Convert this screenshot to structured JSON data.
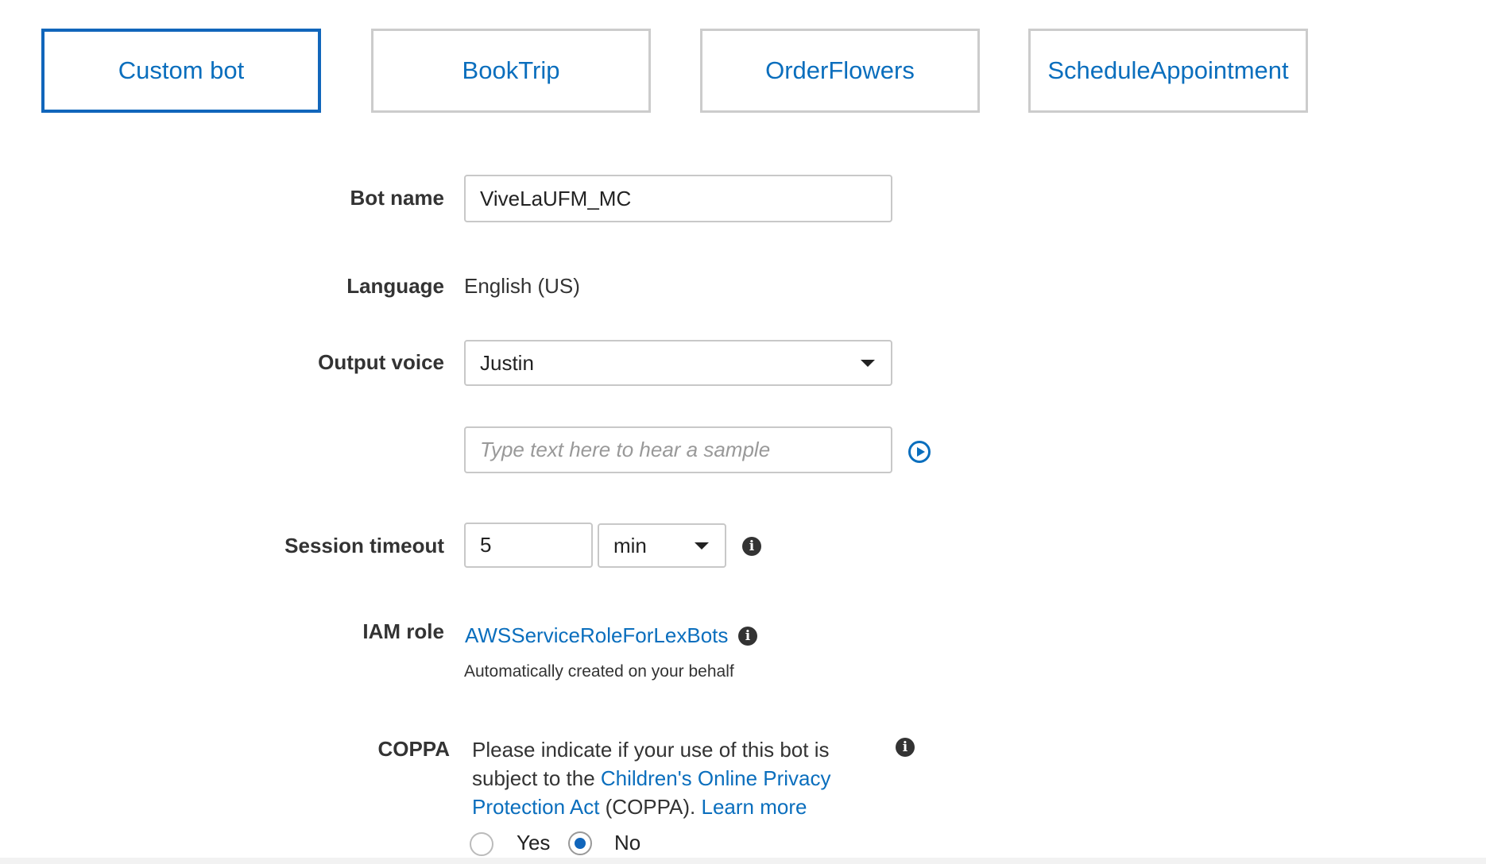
{
  "blueprints": [
    {
      "label": "Custom bot",
      "selected": true
    },
    {
      "label": "BookTrip",
      "selected": false
    },
    {
      "label": "OrderFlowers",
      "selected": false
    },
    {
      "label": "ScheduleAppointment",
      "selected": false
    }
  ],
  "form": {
    "bot_name": {
      "label": "Bot name",
      "value": "ViveLaUFM_MC"
    },
    "language": {
      "label": "Language",
      "value": "English (US)"
    },
    "output_voice": {
      "label": "Output voice",
      "selected": "Justin"
    },
    "sample": {
      "placeholder": "Type text here to hear a sample"
    },
    "session_timeout": {
      "label": "Session timeout",
      "value": "5",
      "unit": "min"
    },
    "iam_role": {
      "label": "IAM role",
      "role_link": "AWSServiceRoleForLexBots",
      "note": "Automatically created on your behalf"
    },
    "coppa": {
      "label": "COPPA",
      "text_before": "Please indicate if your use of this bot is subject to the ",
      "act_link": "Children's Online Privacy Protection Act",
      "text_middle": " (COPPA). ",
      "learn_more": "Learn more",
      "options": [
        {
          "label": "Yes",
          "checked": false
        },
        {
          "label": "No",
          "checked": true
        }
      ]
    }
  },
  "icons": {
    "play": "play-circle-icon",
    "info": "info-icon"
  },
  "colors": {
    "link": "#0a6ebd",
    "selected_border": "#1166bb",
    "card_border": "#cccccc",
    "label_text": "#333333"
  }
}
